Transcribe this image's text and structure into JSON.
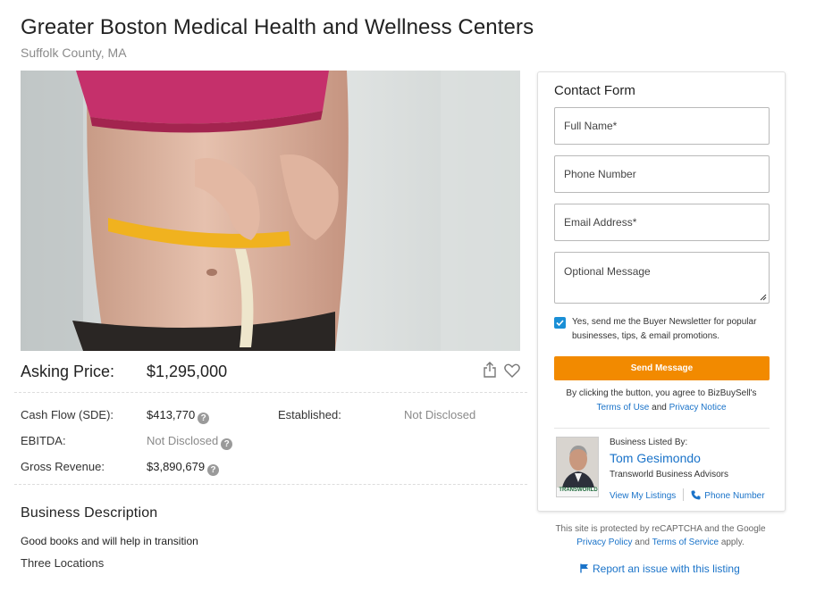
{
  "listing": {
    "title": "Greater Boston Medical Health and Wellness Centers",
    "location": "Suffolk County, MA",
    "asking_price_label": "Asking Price:",
    "asking_price": "$1,295,000"
  },
  "financials": {
    "cash_flow_label": "Cash Flow (SDE):",
    "cash_flow": "$413,770",
    "established_label": "Established:",
    "established": "Not Disclosed",
    "ebitda_label": "EBITDA:",
    "ebitda": "Not Disclosed",
    "gross_revenue_label": "Gross Revenue:",
    "gross_revenue": "$3,890,679",
    "help_glyph": "?"
  },
  "description": {
    "heading": "Business Description",
    "line1": "Good books and will help in transition",
    "line2": "Three Locations"
  },
  "contact_form": {
    "title": "Contact Form",
    "full_name_placeholder": "Full Name*",
    "phone_placeholder": "Phone Number",
    "email_placeholder": "Email Address*",
    "message_placeholder": "Optional Message",
    "newsletter_checked": true,
    "newsletter_label": "Yes, send me the Buyer Newsletter for popular businesses, tips, & email promotions.",
    "send_label": "Send Message",
    "terms_prefix": "By clicking the button, you agree to BizBuySell's",
    "terms_link": "Terms of Use",
    "terms_and": "and",
    "privacy_link": "Privacy Notice"
  },
  "broker": {
    "listed_by_label": "Business Listed By:",
    "name": "Tom Gesimondo",
    "agency": "Transworld Business Advisors",
    "photo_badge": "TRANSWORLD",
    "view_listings": "View My Listings",
    "phone_label": "Phone Number"
  },
  "captcha": {
    "text": "This site is protected by reCAPTCHA and the Google",
    "privacy_link": "Privacy Policy",
    "and": "and",
    "terms_link": "Terms of Service",
    "apply": "apply."
  },
  "report_link": "Report an issue with this listing",
  "colors": {
    "accent_orange": "#f28a00",
    "link_blue": "#1a73c9",
    "checkbox_blue": "#1a8fd6"
  }
}
